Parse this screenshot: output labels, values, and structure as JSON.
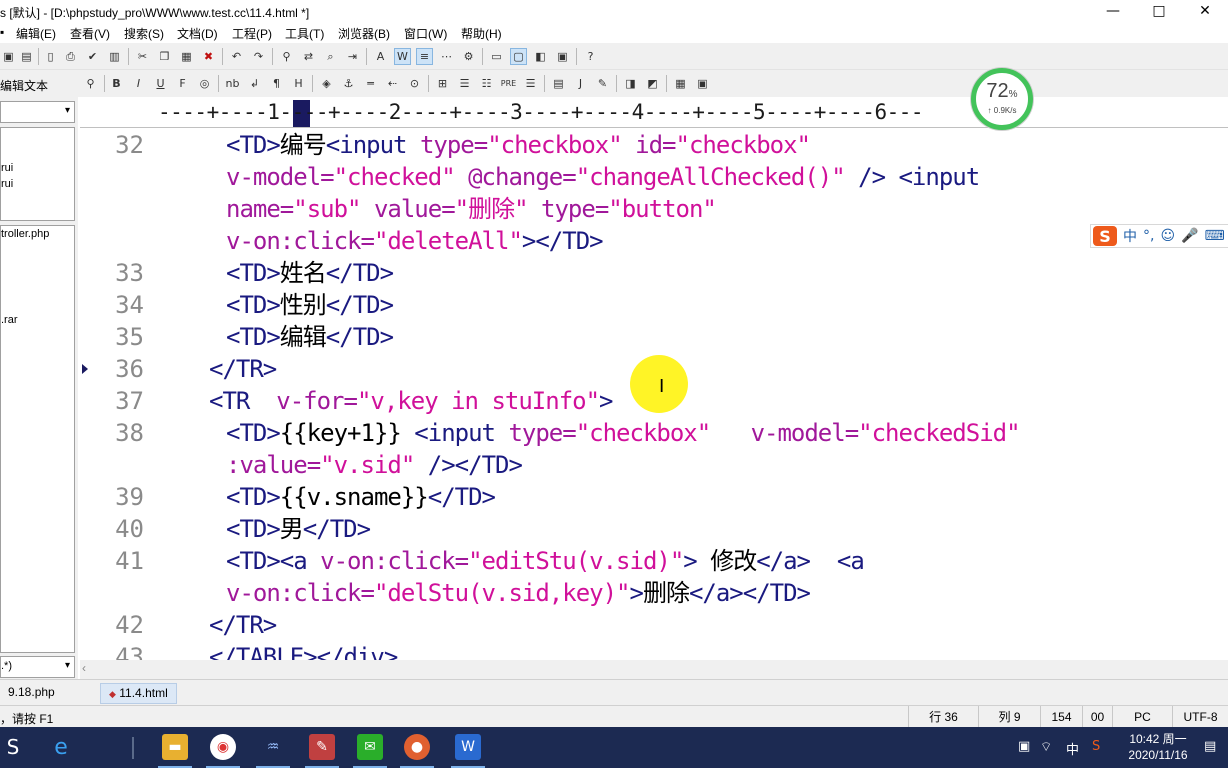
{
  "window": {
    "title": "s [默认] - [D:\\phpstudy_pro\\WWW\\www.test.cc\\11.4.html *]",
    "minimize_glyph": "—",
    "maximize_glyph": "□",
    "close_glyph": "✕"
  },
  "menu": [
    {
      "label": "编辑(E)"
    },
    {
      "label": "查看(V)"
    },
    {
      "label": "搜索(S)"
    },
    {
      "label": "文档(D)"
    },
    {
      "label": "工程(P)"
    },
    {
      "label": "工具(T)"
    },
    {
      "label": "浏览器(B)"
    },
    {
      "label": "窗口(W)"
    },
    {
      "label": "帮助(H)"
    }
  ],
  "toolbar2": {
    "left_label": "编辑文本",
    "bold": "B",
    "italic": "I",
    "underline": "U",
    "font": "F",
    "nbsp": "nb",
    "header": "H",
    "pre": "PRE",
    "j": "J"
  },
  "sidebar": {
    "items": [
      {
        "label": "rui"
      },
      {
        "label": "rui"
      },
      {
        "label": "troller.php"
      },
      {
        "label": ".rar"
      }
    ],
    "filter_value": ".*)"
  },
  "ruler": {
    "marks": "----+----1----+----2----+----3----+----4----+----5----+----6---"
  },
  "network_widget": {
    "percent": "72",
    "percent_unit": "%",
    "speed": "↑ 0.9K/s"
  },
  "ime": {
    "logo": "S",
    "mode": "中",
    "punct": "°,",
    "emoji": "☺",
    "mic": "🎤",
    "keyboard": "⌨"
  },
  "editor": {
    "lines": [
      {
        "num": "32",
        "segments": [
          [
            "t",
            "<TD>"
          ],
          [
            "x",
            "编号"
          ],
          [
            "t",
            "<input "
          ],
          [
            "a",
            "type="
          ],
          [
            "v",
            "\"checkbox\""
          ],
          [
            "x",
            " "
          ],
          [
            "a",
            "id="
          ],
          [
            "v",
            "\"checkbox\""
          ]
        ]
      },
      {
        "num": "",
        "segments": [
          [
            "a",
            "v-model="
          ],
          [
            "v",
            "\"checked\""
          ],
          [
            "x",
            " "
          ],
          [
            "a",
            "@change="
          ],
          [
            "v",
            "\"changeAllChecked()\""
          ],
          [
            "x",
            " "
          ],
          [
            "t",
            "/> <input"
          ]
        ]
      },
      {
        "num": "",
        "segments": [
          [
            "a",
            "name="
          ],
          [
            "v",
            "\"sub\""
          ],
          [
            "x",
            " "
          ],
          [
            "a",
            "value="
          ],
          [
            "v",
            "\"删除\""
          ],
          [
            "x",
            " "
          ],
          [
            "a",
            "type="
          ],
          [
            "v",
            "\"button\""
          ]
        ]
      },
      {
        "num": "",
        "segments": [
          [
            "a",
            "v-on:click="
          ],
          [
            "v",
            "\"deleteAll\""
          ],
          [
            "t",
            "></TD>"
          ]
        ]
      },
      {
        "num": "33",
        "segments": [
          [
            "t",
            "<TD>"
          ],
          [
            "x",
            "姓名"
          ],
          [
            "t",
            "</TD>"
          ]
        ]
      },
      {
        "num": "34",
        "segments": [
          [
            "t",
            "<TD>"
          ],
          [
            "x",
            "性别"
          ],
          [
            "t",
            "</TD>"
          ]
        ]
      },
      {
        "num": "35",
        "segments": [
          [
            "t",
            "<TD>"
          ],
          [
            "x",
            "编辑"
          ],
          [
            "t",
            "</TD>"
          ]
        ]
      },
      {
        "num": "36",
        "segments": [
          [
            "t",
            "</TR>"
          ]
        ]
      },
      {
        "num": "37",
        "segments": [
          [
            "t",
            "<TR  "
          ],
          [
            "a",
            "v-for="
          ],
          [
            "v",
            "\"v,key in stuInfo\""
          ],
          [
            "t",
            ">"
          ]
        ]
      },
      {
        "num": "38",
        "segments": [
          [
            "t",
            "<TD>"
          ],
          [
            "x",
            "{{key+1}} "
          ],
          [
            "t",
            "<input "
          ],
          [
            "a",
            "type="
          ],
          [
            "v",
            "\"checkbox\""
          ],
          [
            "x",
            "   "
          ],
          [
            "a",
            "v-model="
          ],
          [
            "v",
            "\"checkedSid\""
          ]
        ]
      },
      {
        "num": "",
        "segments": [
          [
            "a",
            ":value="
          ],
          [
            "v",
            "\"v.sid\""
          ],
          [
            "x",
            " "
          ],
          [
            "t",
            "/></TD>"
          ]
        ]
      },
      {
        "num": "39",
        "segments": [
          [
            "t",
            "<TD>"
          ],
          [
            "x",
            "{{v.sname}}"
          ],
          [
            "t",
            "</TD>"
          ]
        ]
      },
      {
        "num": "40",
        "segments": [
          [
            "t",
            "<TD>"
          ],
          [
            "x",
            "男"
          ],
          [
            "t",
            "</TD>"
          ]
        ]
      },
      {
        "num": "41",
        "segments": [
          [
            "t",
            "<TD><a "
          ],
          [
            "a",
            "v-on:click="
          ],
          [
            "v",
            "\"editStu(v.sid)\""
          ],
          [
            "t",
            ">"
          ],
          [
            "x",
            " 修改"
          ],
          [
            "t",
            "</a>  <a"
          ]
        ]
      },
      {
        "num": "",
        "segments": [
          [
            "a",
            "v-on:click="
          ],
          [
            "v",
            "\"delStu(v.sid,key)\""
          ],
          [
            "t",
            ">"
          ],
          [
            "x",
            "删除"
          ],
          [
            "t",
            "</a></TD>"
          ]
        ]
      },
      {
        "num": "42",
        "segments": [
          [
            "t",
            "</TR>"
          ]
        ]
      },
      {
        "num": "43",
        "segments": [
          [
            "t",
            "</TABLE></div>"
          ]
        ]
      }
    ]
  },
  "tabs": [
    {
      "label": "9.18.php"
    },
    {
      "label": "11.4.html"
    }
  ],
  "statusbar": {
    "hint": "，请按 F1",
    "line": "行 36",
    "col": "列 9",
    "chars": "154",
    "sel": "00",
    "eol": "PC",
    "encoding": "UTF-8"
  },
  "taskbar": {
    "clock_time": "10:42 周一",
    "clock_date": "2020/11/16",
    "ime_label": "中"
  }
}
